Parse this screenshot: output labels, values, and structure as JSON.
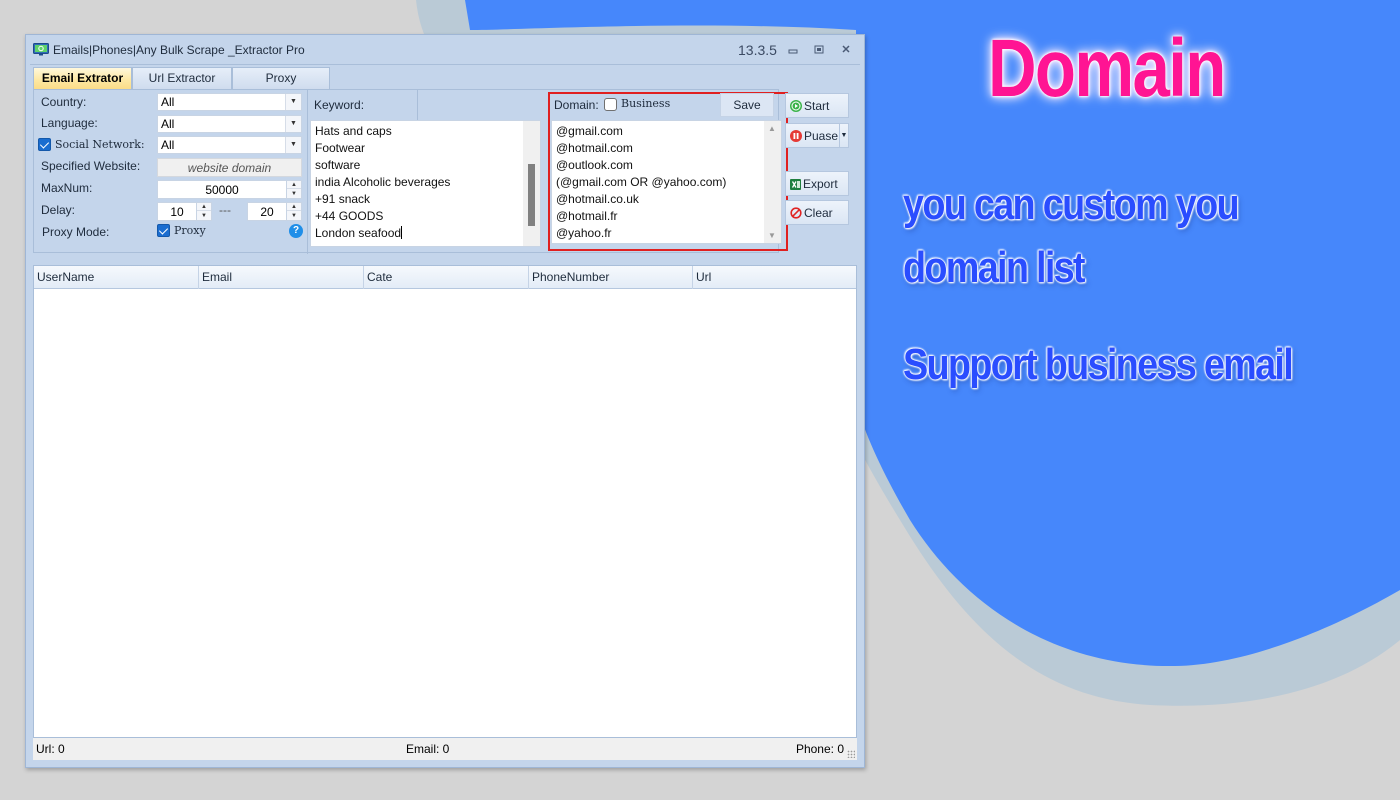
{
  "colors": {
    "page_bg": "#d4d4d4",
    "blob_main": "#4687fb",
    "blob_shadow": "#bacad6",
    "promo_title": "#ff1493",
    "promo_text": "#2a4dff",
    "highlight_frame": "#e02020",
    "window_bg": "#c4d5eb"
  },
  "promo": {
    "title": "Domain",
    "line1": "you can custom you",
    "line2": "domain list",
    "line3": "Support business email"
  },
  "window": {
    "title": "Emails|Phones|Any Bulk Scrape _Extractor Pro",
    "version": "13.3.5",
    "controls": {
      "minimize": "▭",
      "restore": "▣",
      "close": "✕"
    }
  },
  "tabs": [
    {
      "label": "Email Extrator",
      "active": true
    },
    {
      "label": "Url Extractor",
      "active": false
    },
    {
      "label": "Proxy",
      "active": false
    }
  ],
  "settings": {
    "country": {
      "label": "Country:",
      "value": "All"
    },
    "language": {
      "label": "Language:",
      "value": "All"
    },
    "social_network": {
      "label": "Social Network:",
      "value": "All",
      "checked": true
    },
    "specified_website": {
      "label": "Specified Website:",
      "button": "website domain"
    },
    "max_num": {
      "label": "MaxNum:",
      "value": "50000"
    },
    "delay": {
      "label": "Delay:",
      "min": "10",
      "separator": "---",
      "max": "20"
    },
    "proxy_mode": {
      "label": "Proxy Mode:",
      "checkbox_label": "Proxy",
      "checked": true,
      "help": "?"
    }
  },
  "keyword": {
    "label": "Keyword:",
    "lines": [
      "Hats and caps",
      "Footwear",
      "software",
      "india Alcoholic beverages",
      "+91 snack",
      "+44 GOODS",
      "London seafood"
    ]
  },
  "domain": {
    "label": "Domain:",
    "business_label": "Business",
    "business_checked": false,
    "save_label": "Save",
    "lines": [
      "@gmail.com",
      "@hotmail.com",
      "@outlook.com",
      "(@gmail.com OR @yahoo.com)",
      "@hotmail.co.uk",
      "@hotmail.fr",
      "@yahoo.fr"
    ]
  },
  "actions": {
    "start": "Start",
    "pause": "Puase",
    "export": "Export",
    "clear": "Clear"
  },
  "grid": {
    "columns": [
      "UserName",
      "Email",
      "Cate",
      "PhoneNumber",
      "Url"
    ],
    "rows": []
  },
  "status": {
    "url": "Url:  0",
    "email": "Email:  0",
    "phone": "Phone:  0"
  }
}
